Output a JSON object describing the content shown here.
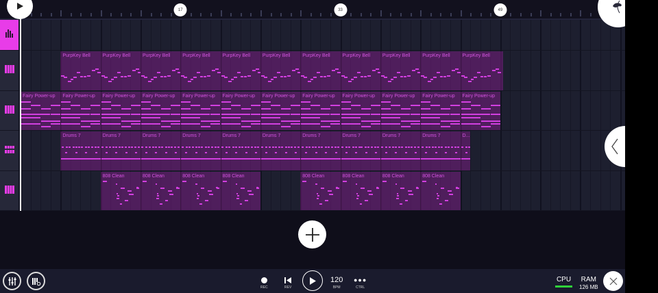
{
  "ruler": {
    "markers": [
      "17",
      "33",
      "49"
    ]
  },
  "tracks": [
    {
      "type": "automation",
      "icon": "equalizer-icon",
      "active": true,
      "clips": []
    },
    {
      "type": "instrument",
      "icon": "piano-keys-icon",
      "name": "PurpKey Bell",
      "clips": [
        [
          5,
          4
        ],
        [
          9,
          4
        ],
        [
          13,
          4
        ],
        [
          17,
          4
        ],
        [
          21,
          4
        ],
        [
          25,
          4
        ],
        [
          29,
          4
        ],
        [
          33,
          4
        ],
        [
          37,
          4
        ],
        [
          41,
          4
        ],
        [
          45,
          4.3
        ]
      ]
    },
    {
      "type": "instrument",
      "icon": "piano-keys-icon",
      "name": "Fairy Power-up",
      "clips": [
        [
          1,
          4
        ],
        [
          5,
          4
        ],
        [
          9,
          4
        ],
        [
          13,
          4
        ],
        [
          17,
          4
        ],
        [
          21,
          4
        ],
        [
          25,
          4
        ],
        [
          29,
          4
        ],
        [
          33,
          4
        ],
        [
          37,
          4
        ],
        [
          41,
          4
        ],
        [
          45,
          4
        ]
      ]
    },
    {
      "type": "drums",
      "icon": "drum-pads-icon",
      "name": "Drums 7",
      "short_name": "D...",
      "clips": [
        [
          5,
          4
        ],
        [
          9,
          4
        ],
        [
          13,
          4
        ],
        [
          17,
          4
        ],
        [
          21,
          4
        ],
        [
          25,
          4
        ],
        [
          29,
          4
        ],
        [
          33,
          4
        ],
        [
          37,
          4
        ],
        [
          41,
          4
        ],
        [
          45,
          1
        ]
      ]
    },
    {
      "type": "instrument",
      "icon": "piano-keys-icon",
      "name": "808 Clean",
      "clips": [
        [
          9,
          4
        ],
        [
          13,
          4
        ],
        [
          17,
          4
        ],
        [
          21,
          4
        ],
        [
          29,
          4
        ],
        [
          33,
          4
        ],
        [
          37,
          4
        ],
        [
          41,
          4
        ]
      ]
    }
  ],
  "transport": {
    "rec": "REC",
    "rev": "REV",
    "bpm_value": "120",
    "bpm": "BPM",
    "ctrl": "CTRL"
  },
  "status": {
    "cpu": "CPU",
    "ram": "RAM",
    "ram_value": "126 MB",
    "cpu_color": "#2fd23a"
  },
  "accent": "#e83ce8"
}
